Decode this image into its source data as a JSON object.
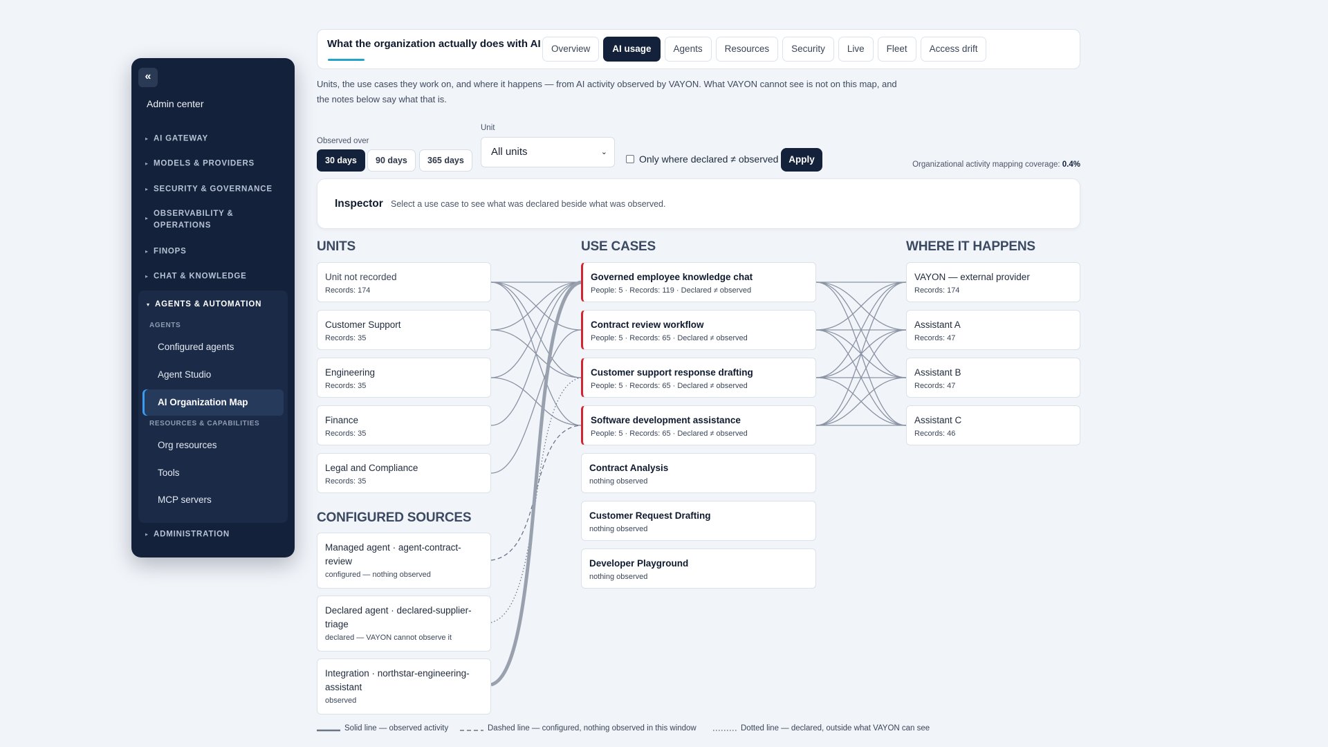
{
  "sidebar": {
    "collapse_label": "«",
    "title": "Admin center",
    "caret_collapsed": "▸",
    "caret_expanded": "▾",
    "nav": [
      "AI GATEWAY",
      "MODELS & PROVIDERS",
      "SECURITY & GOVERNANCE",
      "OBSERVABILITY & OPERATIONS",
      "FINOPS",
      "CHAT & KNOWLEDGE"
    ],
    "group": {
      "label": "AGENTS & AUTOMATION",
      "sub_head_agents": "AGENTS",
      "agents": [
        "Configured agents",
        "Agent Studio",
        "AI Organization Map"
      ],
      "sub_head_resources": "RESOURCES & CAPABILITIES",
      "resources": [
        "Org resources",
        "Tools",
        "MCP servers"
      ],
      "active": "AI Organization Map"
    },
    "admin": "ADMINISTRATION"
  },
  "header": {
    "title": "What the organization actually does with AI",
    "tabs": [
      "Overview",
      "AI usage",
      "Agents",
      "Resources",
      "Security",
      "Live",
      "Fleet",
      "Access drift"
    ],
    "active_tab": "AI usage"
  },
  "description": "Units, the use cases they work on, and where it happens — from AI activity observed by VAYON. What VAYON cannot see is not on this map, and the notes below say what that is.",
  "filters": {
    "observed_over_label": "Observed over",
    "ranges": [
      "30 days",
      "90 days",
      "365 days"
    ],
    "active_range": "30 days",
    "unit_label": "Unit",
    "unit_value": "All units",
    "unit_chevron": "⌄",
    "checkbox_label": "Only where declared ≠ observed",
    "checkbox_checked": false,
    "apply_label": "Apply",
    "coverage_label": "Organizational activity mapping coverage:",
    "coverage_value": "0.4%"
  },
  "inspector": {
    "title": "Inspector",
    "hint": "Select a use case to see what was declared beside what was observed."
  },
  "units": {
    "heading": "UNITS",
    "items": [
      {
        "name": "Unit not recorded",
        "sub": "Records: 174"
      },
      {
        "name": "Customer Support",
        "sub": "Records: 35"
      },
      {
        "name": "Engineering",
        "sub": "Records: 35"
      },
      {
        "name": "Finance",
        "sub": "Records: 35"
      },
      {
        "name": "Legal and Compliance",
        "sub": "Records: 35"
      }
    ]
  },
  "sources": {
    "heading": "CONFIGURED SOURCES",
    "items": [
      {
        "name": "Managed agent · agent-contract-review",
        "sub": "configured — nothing observed"
      },
      {
        "name": "Declared agent · declared-supplier-triage",
        "sub": "declared — VAYON cannot observe it"
      },
      {
        "name": "Integration · northstar-engineering-assistant",
        "sub": "observed"
      }
    ]
  },
  "use_cases": {
    "heading": "USE CASES",
    "items": [
      {
        "name": "Governed employee knowledge chat",
        "sub": "People: 5 · Records: 119 · Declared ≠ observed",
        "flag": true
      },
      {
        "name": "Contract review workflow",
        "sub": "People: 5 · Records: 65 · Declared ≠ observed",
        "flag": true
      },
      {
        "name": "Customer support response drafting",
        "sub": "People: 5 · Records: 65 · Declared ≠ observed",
        "flag": true
      },
      {
        "name": "Software development assistance",
        "sub": "People: 5 · Records: 65 · Declared ≠ observed",
        "flag": true
      },
      {
        "name": "Contract Analysis",
        "sub": "nothing observed",
        "flag": false
      },
      {
        "name": "Customer Request Drafting",
        "sub": "nothing observed",
        "flag": false
      },
      {
        "name": "Developer Playground",
        "sub": "nothing observed",
        "flag": false
      }
    ]
  },
  "locations": {
    "heading": "WHERE IT HAPPENS",
    "items": [
      {
        "name": "VAYON — external provider",
        "sub": "Records: 174"
      },
      {
        "name": "Assistant A",
        "sub": "Records: 47"
      },
      {
        "name": "Assistant B",
        "sub": "Records: 47"
      },
      {
        "name": "Assistant C",
        "sub": "Records: 46"
      }
    ]
  },
  "legend": {
    "solid": "Solid line — observed activity",
    "dashed": "Dashed line — configured, nothing observed in this window",
    "dotted": "Dotted line — declared, outside what VAYON can see"
  },
  "colors": {
    "sidebar_bg": "#13213a",
    "accent": "#22a3c7",
    "flag": "#d2232e",
    "link": "#8a93a3"
  }
}
